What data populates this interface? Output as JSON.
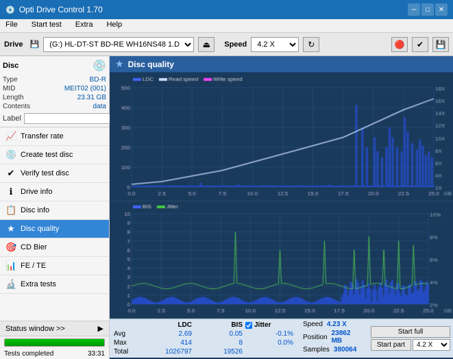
{
  "titlebar": {
    "title": "Opti Drive Control 1.70",
    "icon": "💿",
    "minimize": "─",
    "maximize": "□",
    "close": "✕"
  },
  "menubar": {
    "items": [
      "File",
      "Start test",
      "Extra",
      "Help"
    ]
  },
  "toolbar": {
    "drive_label": "Drive",
    "drive_value": "(G:) HL-DT-ST BD-RE  WH16NS48 1.D3",
    "eject_icon": "⏏",
    "speed_label": "Speed",
    "speed_value": "4.2 X",
    "refresh_icon": "↻",
    "save_icon": "💾",
    "burn_icon": "🔥",
    "verify_icon": "✔"
  },
  "disc": {
    "header": "Disc",
    "type_label": "Type",
    "type_value": "BD-R",
    "mid_label": "MID",
    "mid_value": "MEIT02 (001)",
    "length_label": "Length",
    "length_value": "23.31 GB",
    "contents_label": "Contents",
    "contents_value": "data",
    "label_label": "Label",
    "label_value": ""
  },
  "nav": {
    "items": [
      {
        "id": "transfer-rate",
        "icon": "📈",
        "label": "Transfer rate",
        "active": false
      },
      {
        "id": "create-test-disc",
        "icon": "💿",
        "label": "Create test disc",
        "active": false
      },
      {
        "id": "verify-test-disc",
        "icon": "✔",
        "label": "Verify test disc",
        "active": false
      },
      {
        "id": "drive-info",
        "icon": "ℹ",
        "label": "Drive info",
        "active": false
      },
      {
        "id": "disc-info",
        "icon": "📋",
        "label": "Disc info",
        "active": false
      },
      {
        "id": "disc-quality",
        "icon": "★",
        "label": "Disc quality",
        "active": true
      },
      {
        "id": "cd-bier",
        "icon": "🎯",
        "label": "CD Bier",
        "active": false
      },
      {
        "id": "fe-te",
        "icon": "📊",
        "label": "FE / TE",
        "active": false
      },
      {
        "id": "extra-tests",
        "icon": "🔬",
        "label": "Extra tests",
        "active": false
      }
    ]
  },
  "content": {
    "title": "Disc quality",
    "icon": "★",
    "chart1": {
      "legend": [
        {
          "label": "LDC",
          "color": "#4444ff"
        },
        {
          "label": "Read speed",
          "color": "#ffffff"
        },
        {
          "label": "Write speed",
          "color": "#ff44ff"
        }
      ],
      "y_max": 500,
      "y_right_max": 18,
      "x_max": 25
    },
    "chart2": {
      "legend": [
        {
          "label": "BIS",
          "color": "#4444ff"
        },
        {
          "label": "Jitter",
          "color": "#ffffff"
        }
      ],
      "y_max": 10,
      "y_right_max": 10,
      "x_max": 25
    }
  },
  "stats": {
    "col_headers": [
      "",
      "LDC",
      "BIS",
      "",
      "Jitter",
      "Speed",
      ""
    ],
    "avg_label": "Avg",
    "avg_ldc": "2.69",
    "avg_bis": "0.05",
    "avg_jitter": "-0.1%",
    "max_label": "Max",
    "max_ldc": "414",
    "max_bis": "8",
    "max_jitter": "0.0%",
    "total_label": "Total",
    "total_ldc": "1026797",
    "total_bis": "19526",
    "speed_label": "Speed",
    "speed_value": "4.23 X",
    "position_label": "Position",
    "position_value": "23862 MB",
    "samples_label": "Samples",
    "samples_value": "380064",
    "start_full_label": "Start full",
    "start_part_label": "Start part",
    "speed_select": "4.2 X",
    "jitter_checkbox": true,
    "jitter_label": "Jitter"
  },
  "statusbar": {
    "status_window_label": "Status window >>",
    "status_text": "Tests completed",
    "progress_value": "100.0%",
    "time_value": "33:31"
  }
}
